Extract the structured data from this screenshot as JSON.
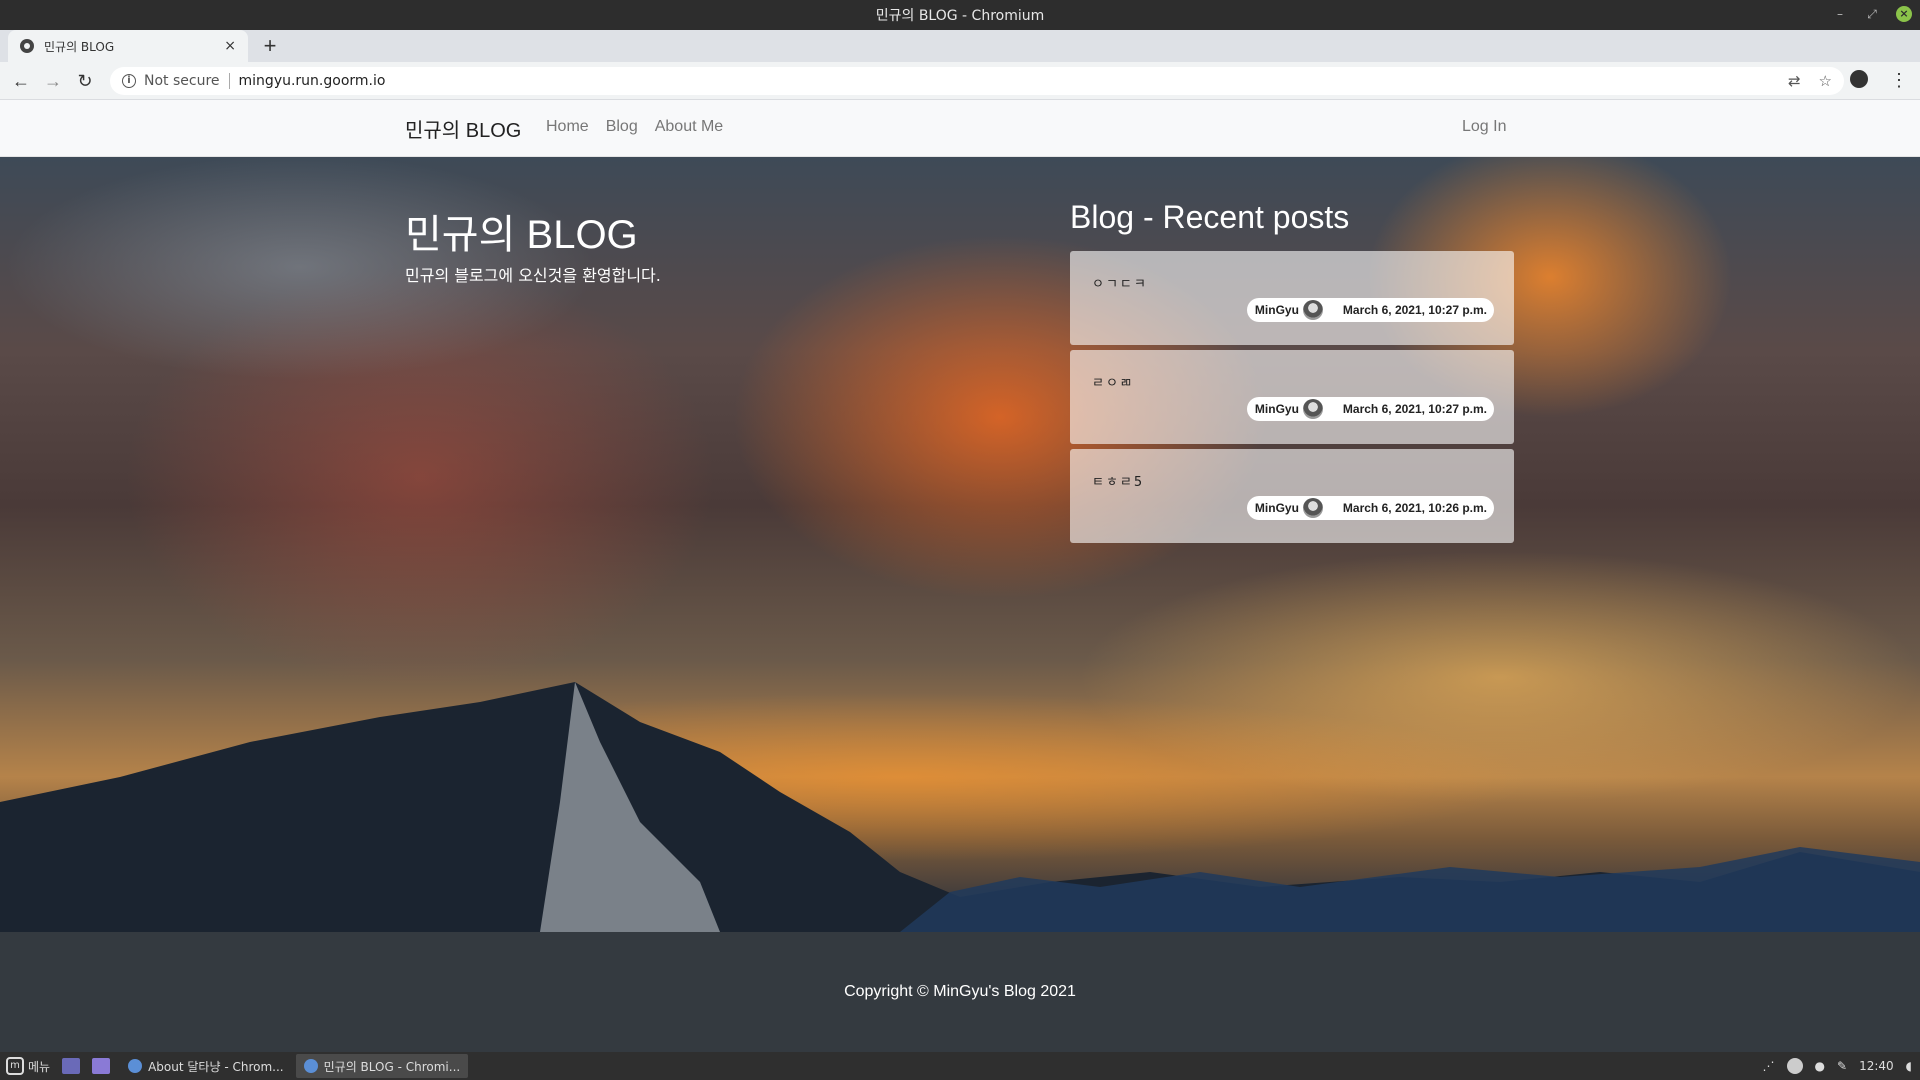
{
  "window": {
    "title": "민규의 BLOG - Chromium"
  },
  "browser": {
    "tab": {
      "title": "민규의 BLOG",
      "close": "×"
    },
    "new_tab": "+",
    "security": "Not secure",
    "url": "mingyu.run.goorm.io"
  },
  "site": {
    "brand": "민규의 BLOG",
    "nav": [
      "Home",
      "Blog",
      "About Me"
    ],
    "login": "Log In",
    "hero_title": "민규의 BLOG",
    "hero_subtitle": "민규의 블로그에 오신것을 환영합니다.",
    "recent_title": "Blog - Recent posts",
    "posts": [
      {
        "title": "ㅇㄱㄷㅋ",
        "author": "MinGyu",
        "date": "March 6, 2021, 10:27 p.m."
      },
      {
        "title": "ㄹㅇㄻ",
        "author": "MinGyu",
        "date": "March 6, 2021, 10:27 p.m."
      },
      {
        "title": "ㅌㅎㄹ5",
        "author": "MinGyu",
        "date": "March 6, 2021, 10:26 p.m."
      }
    ],
    "footer": "Copyright © MinGyu's Blog 2021"
  },
  "taskbar": {
    "menu": "메뉴",
    "tasks": [
      "About 달타냥 - Chrom...",
      "민규의 BLOG - Chromi..."
    ],
    "clock": "12:40"
  },
  "colors": {
    "navbar_bg": "#f8f9fa",
    "footer_bg": "#343a40"
  }
}
